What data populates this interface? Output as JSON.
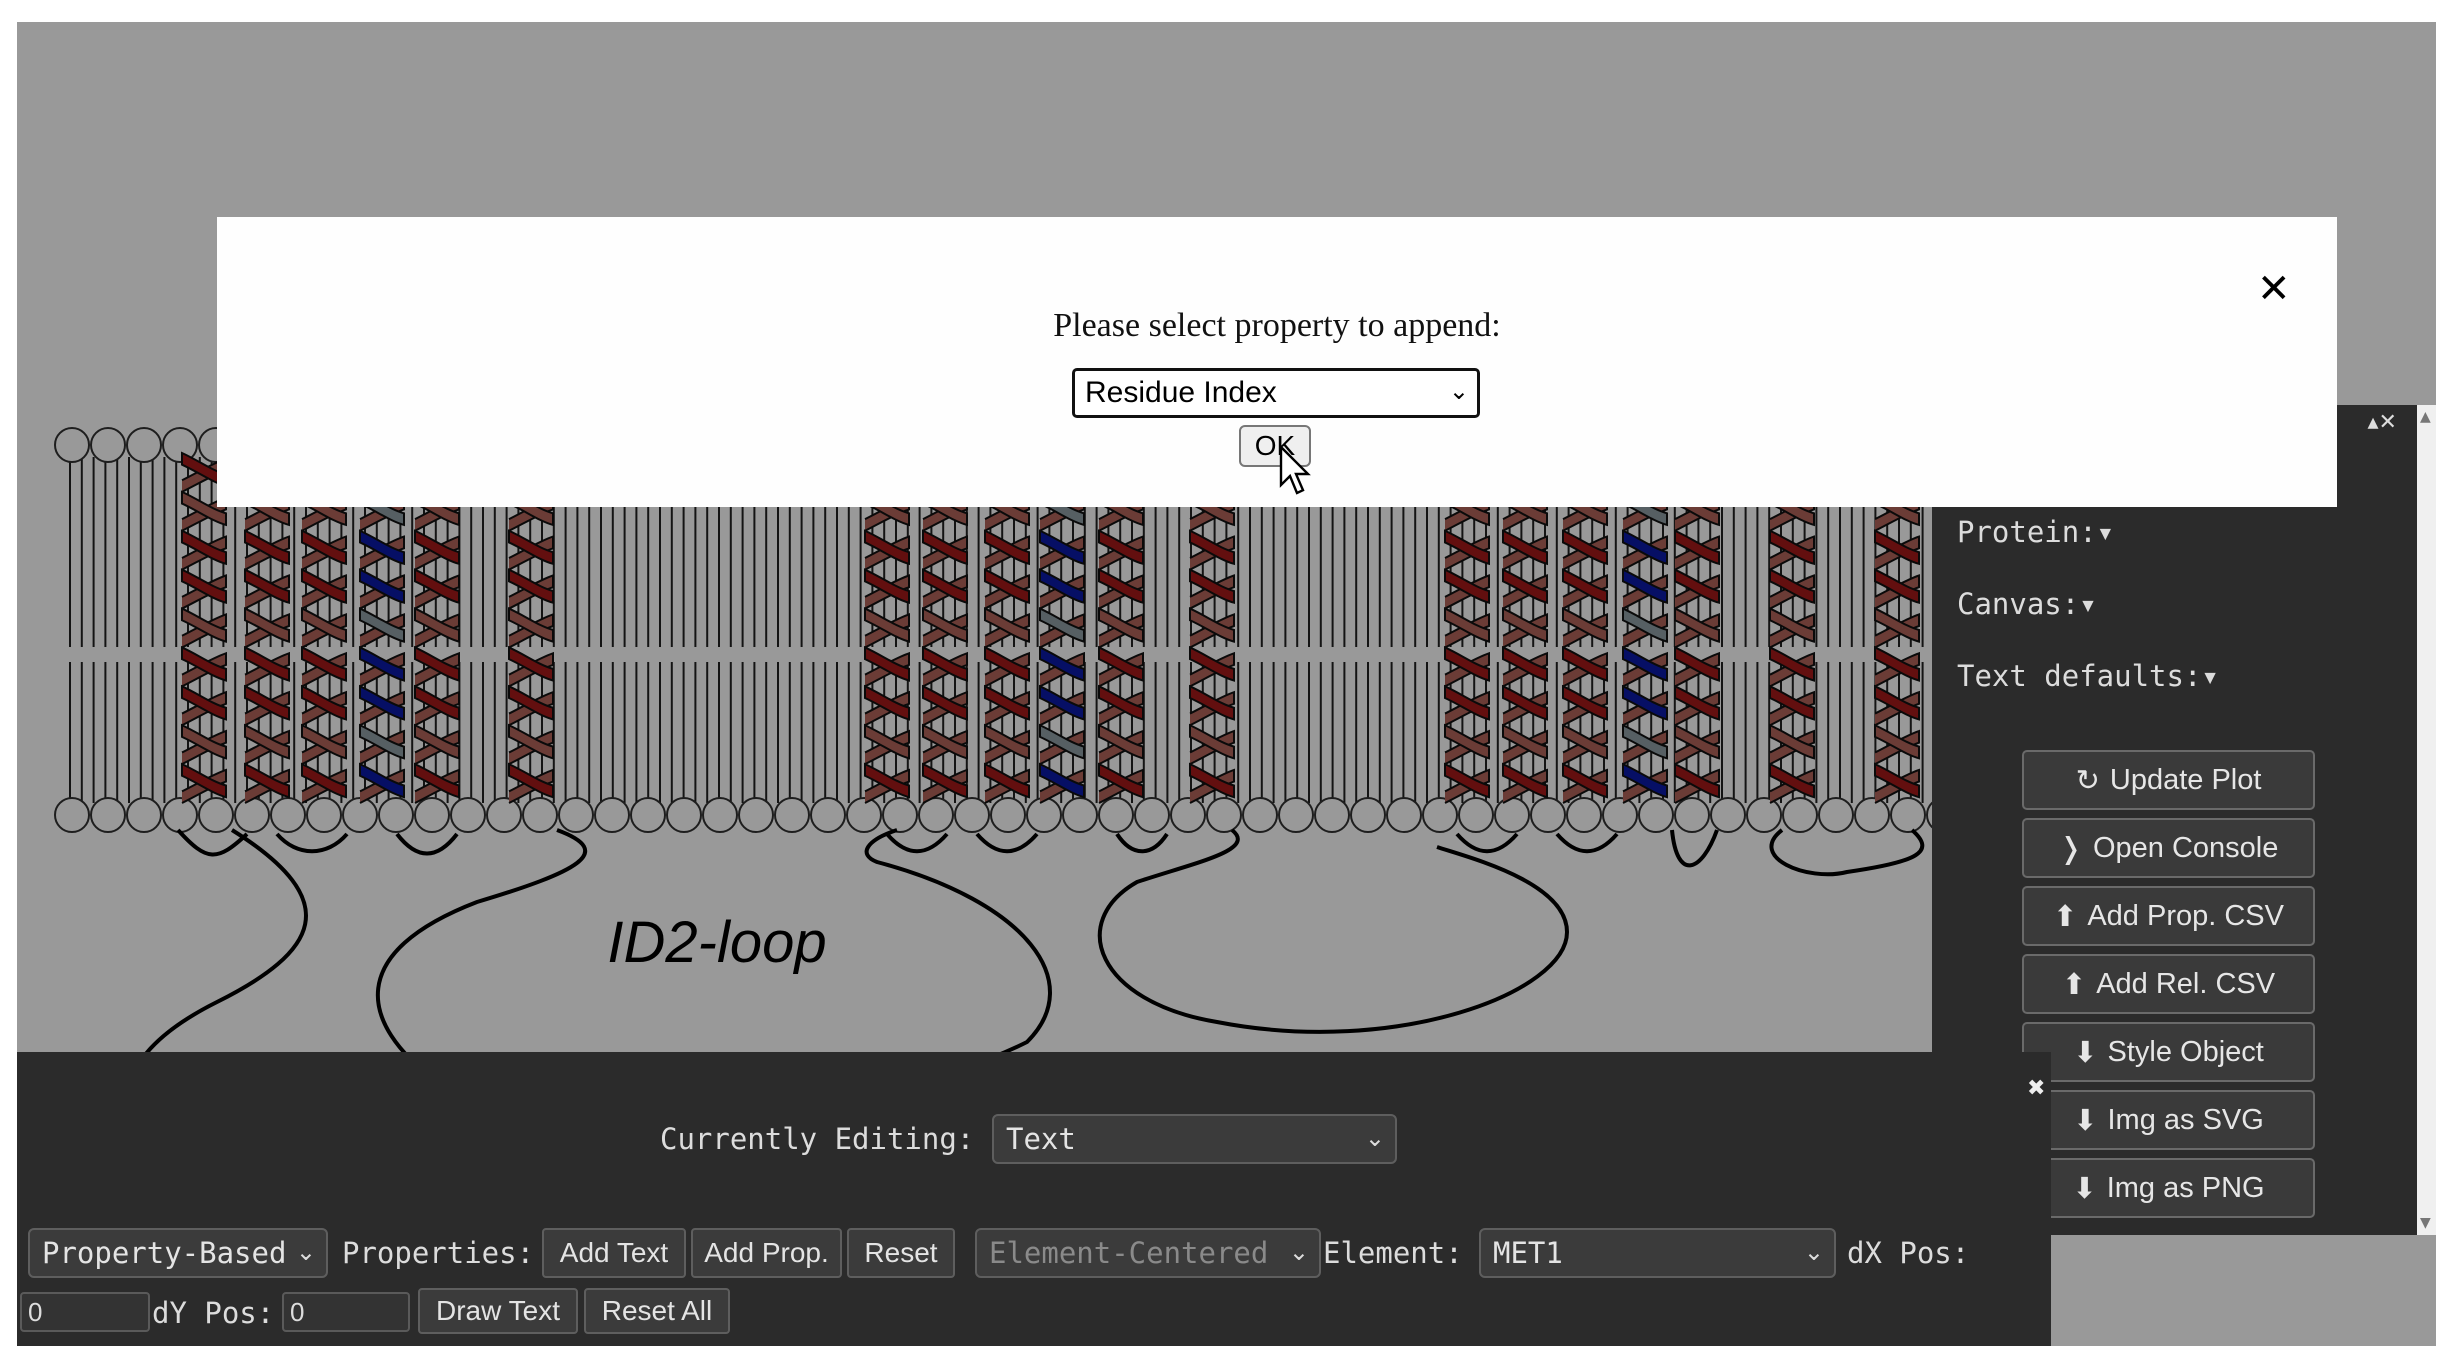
{
  "modal": {
    "message": "Please select property to append:",
    "close_label": "✕",
    "select_value": "Residue Index",
    "ok_label": "OK"
  },
  "diagram": {
    "loop_label": "ID2-loop",
    "helix_colors": {
      "red": "#a61a1a",
      "salmon": "#b3645b",
      "blue": "#0a1aa8",
      "grey": "#8f9fa6"
    }
  },
  "side_panel": {
    "window_controls": "▴✕",
    "protein_label": "Protein:▾",
    "canvas_label": "Canvas:▾",
    "text_defaults_label": "Text defaults:▾",
    "buttons": [
      {
        "icon": "↻",
        "label": "Update Plot"
      },
      {
        "icon": "❭",
        "label": "Open Console"
      },
      {
        "icon": "⬆",
        "label": "Add Prop. CSV"
      },
      {
        "icon": "⬆",
        "label": "Add Rel. CSV"
      },
      {
        "icon": "⬇",
        "label": "Style Object"
      },
      {
        "icon": "⬇",
        "label": "Img as SVG"
      },
      {
        "icon": "⬇",
        "label": "Img as PNG"
      }
    ]
  },
  "bottom_panel": {
    "close_label": "✖",
    "currently_editing_label": "Currently Editing:",
    "currently_editing_value": "Text",
    "mode_select": "Property-Based",
    "properties_label": "Properties:",
    "add_text_label": "Add Text",
    "add_prop_label": "Add Prop.",
    "reset_label": "Reset",
    "anchor_select": "Element-Centered",
    "element_label": "Element:",
    "element_value": "MET1",
    "dx_label": "dX Pos:",
    "dx_value": "0",
    "dy_label": "dY Pos:",
    "dy_value": "0",
    "draw_text_label": "Draw Text",
    "reset_all_label": "Reset All"
  }
}
